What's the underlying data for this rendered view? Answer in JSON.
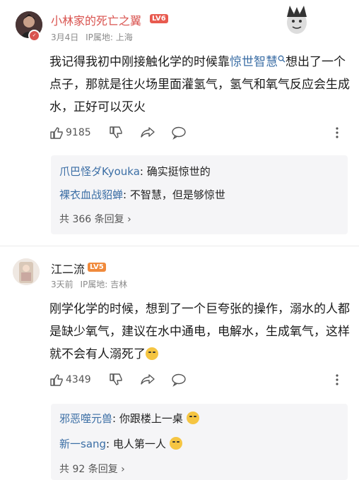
{
  "posts": [
    {
      "username": "小林家的死亡之翼",
      "level": "LV6",
      "date": "3月4日",
      "location": "IP属地: 上海",
      "body_before": "我记得我初中刚接触化学的时候靠",
      "body_link": "惊世智慧",
      "body_after": "想出了一个点子，那就是往火场里面灌氢气，氢气和氧气反应会生成水，正好可以灭火",
      "likes": "9185",
      "replies": [
        {
          "name": "爪巴怪ダKyouka",
          "text": ": 确实挺惊世的"
        },
        {
          "name": "裸衣血战貂蝉",
          "text": ": 不智慧，但是够惊世"
        }
      ],
      "more_replies": "共 366 条回复 ›"
    },
    {
      "username": "江二流",
      "level": "LV5",
      "date": "3天前",
      "location": "IP属地: 吉林",
      "body_before": "刚学化学的时候，想到了一个巨夸张的操作，溺水的人都是缺少氧气，建议在水中通电，电解水，生成氧气，这样就不会有人溺死了",
      "likes": "4349",
      "replies": [
        {
          "name": "邪恶噬元兽",
          "text": ": 你跟楼上一桌"
        },
        {
          "name": "新一sang",
          "text": ": 电人第一人"
        }
      ],
      "more_replies": "共 92 条回复 ›"
    }
  ],
  "colors": {
    "link": "#3b6ea5",
    "level6": "#e85a4f",
    "level5": "#f08a3c"
  }
}
